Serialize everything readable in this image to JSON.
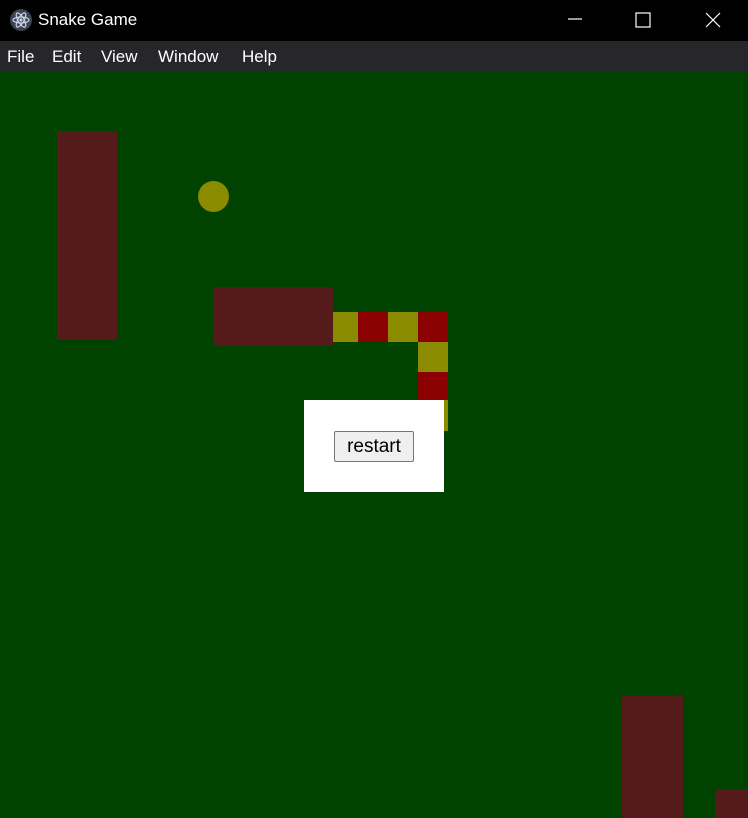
{
  "window": {
    "title": "Snake Game",
    "icon": "electron-atom-icon",
    "controls": [
      "minimize-icon",
      "maximize-icon",
      "close-icon"
    ]
  },
  "menu": {
    "items": [
      "File",
      "Edit",
      "View",
      "Window",
      "Help"
    ]
  },
  "game": {
    "state": "game-over",
    "colors": {
      "background": "#004200",
      "wall": "#551a1a",
      "snake_a": "#8b8b00",
      "snake_b": "#8b0000",
      "food": "#8b8b00"
    },
    "restart_label": "restart"
  }
}
